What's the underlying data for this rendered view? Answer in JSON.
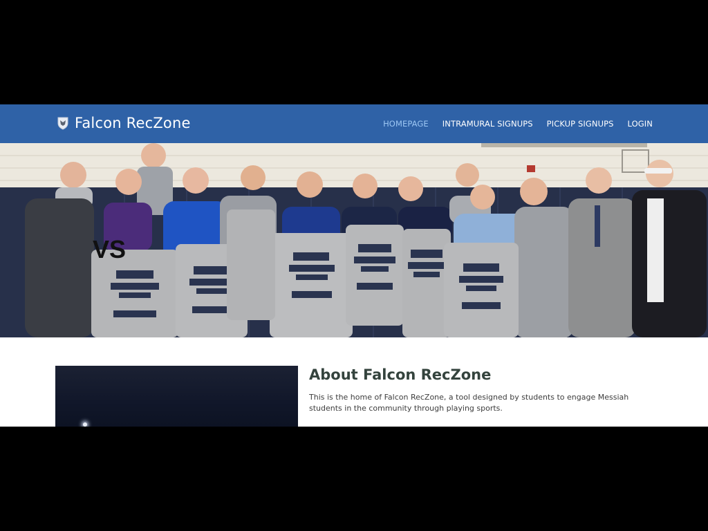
{
  "navbar": {
    "brand": "Falcon RecZone",
    "brand_icon": "falcon-shield-icon",
    "background": "#2f62a7",
    "links": [
      {
        "label": "HOMEPAGE",
        "active": true
      },
      {
        "label": "INTRAMURAL SIGNUPS",
        "active": false
      },
      {
        "label": "PICKUP SIGNUPS",
        "active": false
      },
      {
        "label": "LOGIN",
        "active": false
      }
    ],
    "active_color": "#9cc6f3"
  },
  "hero": {
    "overlay_text": "VS",
    "shirt_lines": [
      "MESSIAH",
      "INTRAMURAL",
      "SPORTS",
      "CHAMPION"
    ]
  },
  "about": {
    "title": "About Falcon RecZone",
    "text": "This is the home of Falcon RecZone, a tool designed by students to engage Messiah students in the community through playing sports."
  }
}
